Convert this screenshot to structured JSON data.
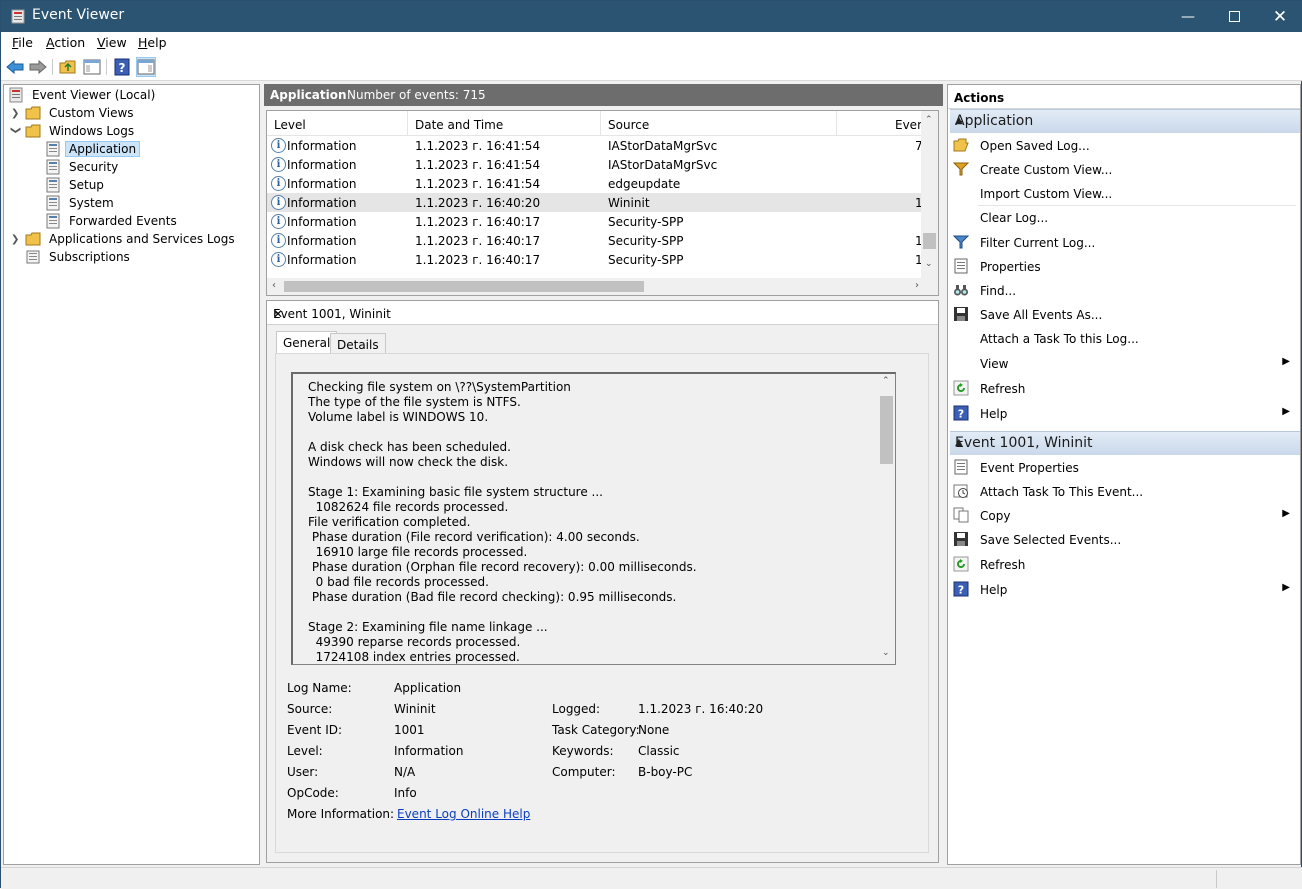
{
  "window": {
    "title": "Event Viewer"
  },
  "menu": [
    "File",
    "Action",
    "View",
    "Help"
  ],
  "menu_accel": [
    "F",
    "A",
    "V",
    "H"
  ],
  "tree": {
    "root": "Event Viewer (Local)",
    "custom_views": "Custom Views",
    "windows_logs": "Windows Logs",
    "application": "Application",
    "security": "Security",
    "setup": "Setup",
    "system": "System",
    "forwarded": "Forwarded Events",
    "apps_services": "Applications and Services Logs",
    "subscriptions": "Subscriptions"
  },
  "list": {
    "title": "Application",
    "count_text": "Number of events: 715",
    "columns": [
      "Level",
      "Date and Time",
      "Source",
      "Even"
    ],
    "rows": [
      {
        "level": "Information",
        "date": "1.1.2023 г. 16:41:54",
        "source": "IAStorDataMgrSvc",
        "event": "7"
      },
      {
        "level": "Information",
        "date": "1.1.2023 г. 16:41:54",
        "source": "IAStorDataMgrSvc",
        "event": ""
      },
      {
        "level": "Information",
        "date": "1.1.2023 г. 16:41:54",
        "source": "edgeupdate",
        "event": ""
      },
      {
        "level": "Information",
        "date": "1.1.2023 г. 16:40:20",
        "source": "Wininit",
        "event": "1"
      },
      {
        "level": "Information",
        "date": "1.1.2023 г. 16:40:17",
        "source": "Security-SPP",
        "event": ""
      },
      {
        "level": "Information",
        "date": "1.1.2023 г. 16:40:17",
        "source": "Security-SPP",
        "event": "1"
      },
      {
        "level": "Information",
        "date": "1.1.2023 г. 16:40:17",
        "source": "Security-SPP",
        "event": "1"
      }
    ]
  },
  "detail": {
    "title": "Event 1001, Wininit",
    "tabs": [
      "General",
      "Details"
    ],
    "message": "Checking file system on \\??\\SystemPartition\nThe type of the file system is NTFS.\nVolume label is WINDOWS 10.\n\nA disk check has been scheduled.\nWindows will now check the disk.\n\nStage 1: Examining basic file system structure ...\n  1082624 file records processed.\nFile verification completed.\n Phase duration (File record verification): 4.00 seconds.\n  16910 large file records processed.\n Phase duration (Orphan file record recovery): 0.00 milliseconds.\n  0 bad file records processed.\n Phase duration (Bad file record checking): 0.95 milliseconds.\n\nStage 2: Examining file name linkage ...\n  49390 reparse records processed.\n  1724108 index entries processed.",
    "labels": {
      "log_name": "Log Name:",
      "source": "Source:",
      "event_id": "Event ID:",
      "level": "Level:",
      "user": "User:",
      "opcode": "OpCode:",
      "more_info": "More Information:",
      "logged": "Logged:",
      "task_category": "Task Category:",
      "keywords": "Keywords:",
      "computer": "Computer:"
    },
    "values": {
      "log_name": "Application",
      "source": "Wininit",
      "event_id": "1001",
      "level": "Information",
      "user": "N/A",
      "opcode": "Info",
      "more_info": "Event Log Online Help",
      "logged": "1.1.2023 г. 16:40:20",
      "task_category": "None",
      "keywords": "Classic",
      "computer": "B-boy-PC"
    }
  },
  "actions": {
    "header": "Actions",
    "group1": "Application",
    "group1_items": [
      "Open Saved Log...",
      "Create Custom View...",
      "Import Custom View...",
      "Clear Log...",
      "Filter Current Log...",
      "Properties",
      "Find...",
      "Save All Events As...",
      "Attach a Task To this Log...",
      "View",
      "Refresh",
      "Help"
    ],
    "group2": "Event 1001, Wininit",
    "group2_items": [
      "Event Properties",
      "Attach Task To This Event...",
      "Copy",
      "Save Selected Events...",
      "Refresh",
      "Help"
    ]
  },
  "colors": {
    "titlebar": "#2b5472",
    "selection": "#cce4f7",
    "link": "#0b3ebf",
    "group_header": "#c9d8ea"
  }
}
